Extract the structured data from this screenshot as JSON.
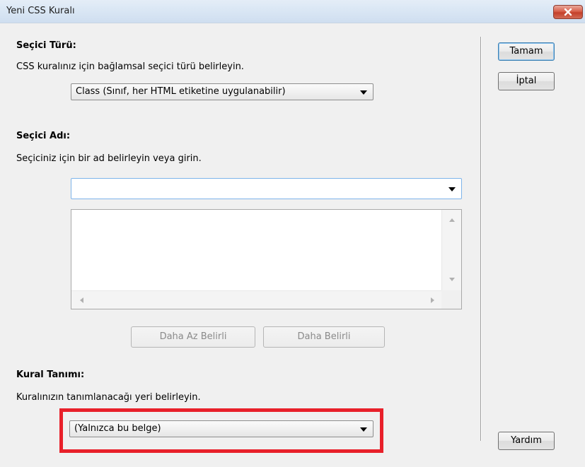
{
  "window": {
    "title": "Yeni CSS Kuralı"
  },
  "selector_type": {
    "heading": "Seçici Türü:",
    "description": "CSS kuralınız için bağlamsal seçici türü belirleyin.",
    "selected": "Class (Sınıf, her HTML etiketine uygulanabilir)"
  },
  "selector_name": {
    "heading": "Seçici Adı:",
    "description": "Seçiciniz için bir ad belirleyin veya girin.",
    "value": "",
    "less_specific_label": "Daha Az Belirli",
    "more_specific_label": "Daha Belirli"
  },
  "rule_definition": {
    "heading": "Kural Tanımı:",
    "description": "Kuralınızın tanımlanacağı yeri belirleyin.",
    "selected": "(Yalnızca bu belge)"
  },
  "buttons": {
    "ok_label": "Tamam",
    "cancel_label": "İptal",
    "help_label": "Yardım"
  },
  "colors": {
    "highlight": "#e8202a",
    "close_button": "#c4402a"
  },
  "icons": {
    "close": "close-icon",
    "dropdown": "chevron-down-icon"
  }
}
